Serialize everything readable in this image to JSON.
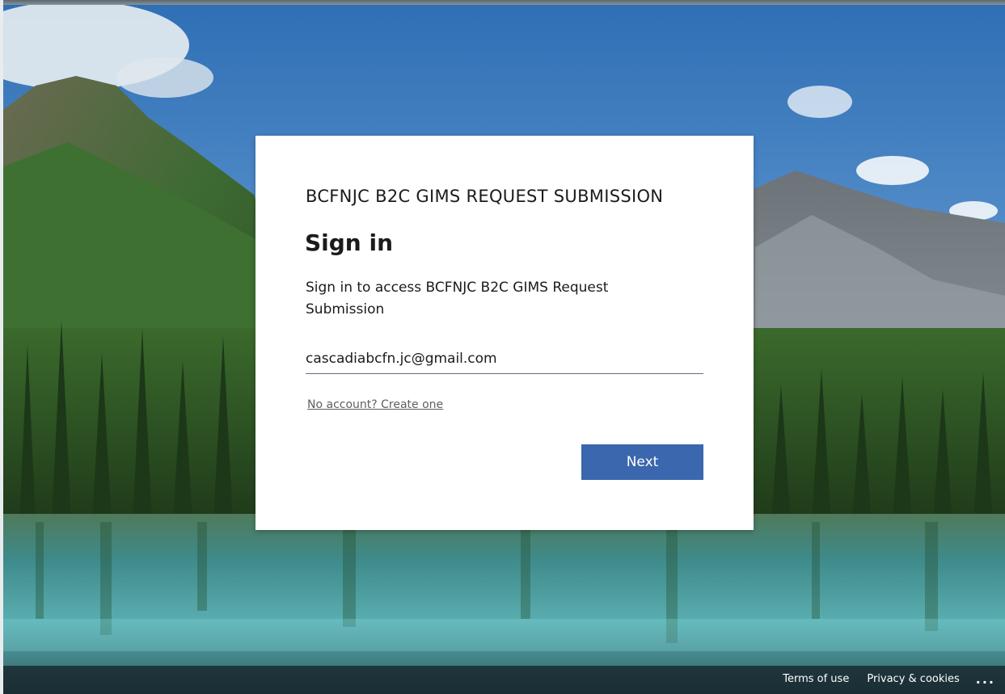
{
  "card": {
    "brand_title": "BCFNJC B2C GIMS REQUEST SUBMISSION",
    "heading": "Sign in",
    "description": "Sign in to access BCFNJC B2C GIMS Request Submission",
    "email_value": "cascadiabcfn.jc@gmail.com",
    "create_account_link": "No account? Create one",
    "next_button": "Next"
  },
  "footer": {
    "terms": "Terms of use",
    "privacy": "Privacy & cookies",
    "more": "..."
  },
  "colors": {
    "accent": "#3a67ad",
    "card_background": "#ffffff",
    "footer_background": "#141c24"
  },
  "background_image": "mountain lake with pine forest"
}
